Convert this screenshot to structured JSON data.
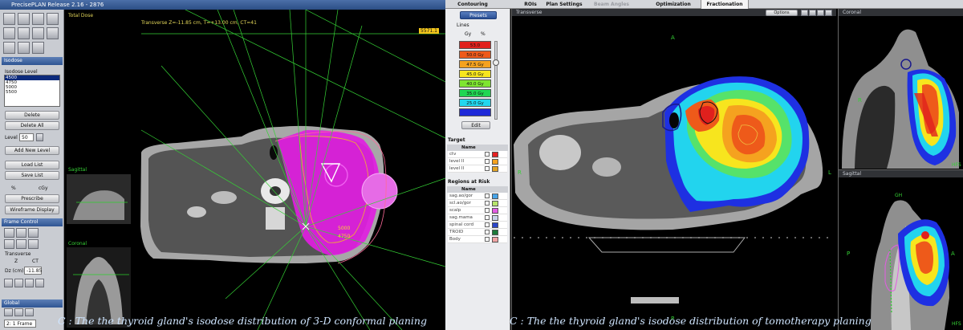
{
  "left_app": {
    "title": "PrecisePLAN Release 2.16 - 2876",
    "isodose_section": "Isodose",
    "isodose_level_label": "Isodose Level",
    "isodose_levels": [
      "4500",
      "4750",
      "5000",
      "5500"
    ],
    "buttons": {
      "delete": "Delete",
      "delete_all": "Delete All",
      "add_new_level": "Add New Level",
      "load_list": "Load List",
      "save_list": "Save List",
      "prescribe": "Prescribe",
      "wireframe_display": "Wireframe Display"
    },
    "level_label": "Level",
    "level_value": "50",
    "unit_percent": "%",
    "unit_cgy": "cGy",
    "frame_control_section": "Frame Control",
    "transverse_label": "Transverse",
    "z_label": "Z",
    "ct_label": "CT",
    "dz_label": "Dz (cm)",
    "dz_value": "-11.85",
    "global_section": "Global",
    "frame_select": "2: 1 Frame",
    "view_labels": {
      "total_dose": "Total Dose",
      "transverse": "Transverse Z=-11.85 cm, T=+13.00 cm, CT=41",
      "sagittal": "Sagittal",
      "coronal": "Coronal",
      "badge": "5571.1"
    },
    "iso_labels": [
      "5000",
      "4750"
    ],
    "caption": "C : The the thyroid gland's isodose distribution of 3-D conformal planing"
  },
  "right_app": {
    "tabs": [
      "Contouring",
      "ROIs",
      "Plan Settings",
      "Beam Angles",
      "Optimization",
      "Fractionation"
    ],
    "presets_label": "Presets",
    "lines_label": "Lines",
    "gy_label": "Gy",
    "pct_label": "%",
    "dose_bands": [
      {
        "label": "53.0",
        "color": "#e0201d"
      },
      {
        "label": "50.0 Gy",
        "color": "#ee5a1a"
      },
      {
        "label": "47.5 Gy",
        "color": "#f5a21f"
      },
      {
        "label": "45.0 Gy",
        "color": "#f7e51e"
      },
      {
        "label": "40.0 Gy",
        "color": "#7ee630"
      },
      {
        "label": "35.0 Gy",
        "color": "#21d653"
      },
      {
        "label": "25.0 Gy",
        "color": "#22d6ee"
      },
      {
        "label": "",
        "color": "#1e29d8"
      }
    ],
    "edit_label": "Edit",
    "target_section": "Target",
    "name_header": "Name",
    "targets": [
      {
        "name": "ctv",
        "color": "#e52222"
      },
      {
        "name": "level II",
        "color": "#f5a21f"
      },
      {
        "name": "level II",
        "color": "#e2a324"
      }
    ],
    "oar_section": "Regions at Risk",
    "oars": [
      {
        "name": "sag.ao/gor",
        "color": "#48a4e8"
      },
      {
        "name": "scl.ao/gor",
        "color": "#b6e46a"
      },
      {
        "name": "scalp",
        "color": "#e35ce3"
      },
      {
        "name": "sag.mama",
        "color": "#c8d3e8"
      },
      {
        "name": "spinal cord",
        "color": "#2b45c8"
      },
      {
        "name": "TROID",
        "color": "#1d7a3a"
      },
      {
        "name": "Body",
        "color": "#f0a3a3"
      }
    ],
    "transverse_title": "Transverse",
    "options_label": "Options",
    "coronal_title": "Coronal",
    "sagittal_title": "Sagittal",
    "orient": {
      "a": "A",
      "p": "P",
      "r": "R",
      "l": "L",
      "hfs": "HFS",
      "gh": "GH"
    },
    "caption": "C : The the thyroid gland's isodose distribution of tomotherapy planing"
  }
}
